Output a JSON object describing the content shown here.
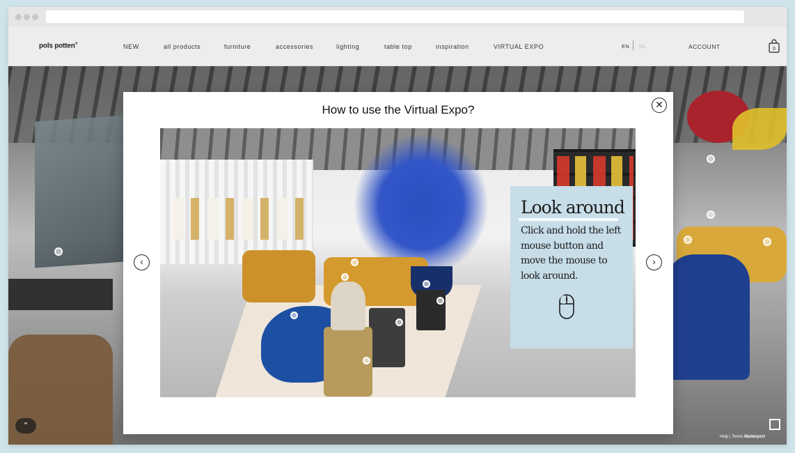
{
  "header": {
    "logo": "pols potten",
    "logo_mark": "®",
    "nav": [
      "NEW",
      "all products",
      "furniture",
      "accessories",
      "lighting",
      "table top",
      "inspiration",
      "VIRTUAL EXPO"
    ],
    "lang_active": "EN",
    "lang_inactive": "NL",
    "account_label": "ACCOUNT",
    "cart_count": "0"
  },
  "modal": {
    "title": "How to use the Virtual Expo?",
    "close_icon": "close-icon",
    "prev_icon": "chevron-left-icon",
    "next_icon": "chevron-right-icon",
    "card_title": "Look around",
    "card_text": "Click and hold the left mouse button and move the mouse to look around.",
    "card_icon": "mouse-icon"
  },
  "tour": {
    "footer_help": "Help",
    "footer_sep": "|",
    "footer_terms": "Terms",
    "footer_brand": "Matterport",
    "scroll_up_icon": "chevron-up-icon",
    "fullscreen_icon": "fullscreen-icon"
  },
  "colors": {
    "card_bg": "#c7dde8",
    "page_bg": "#cfe3ea"
  }
}
